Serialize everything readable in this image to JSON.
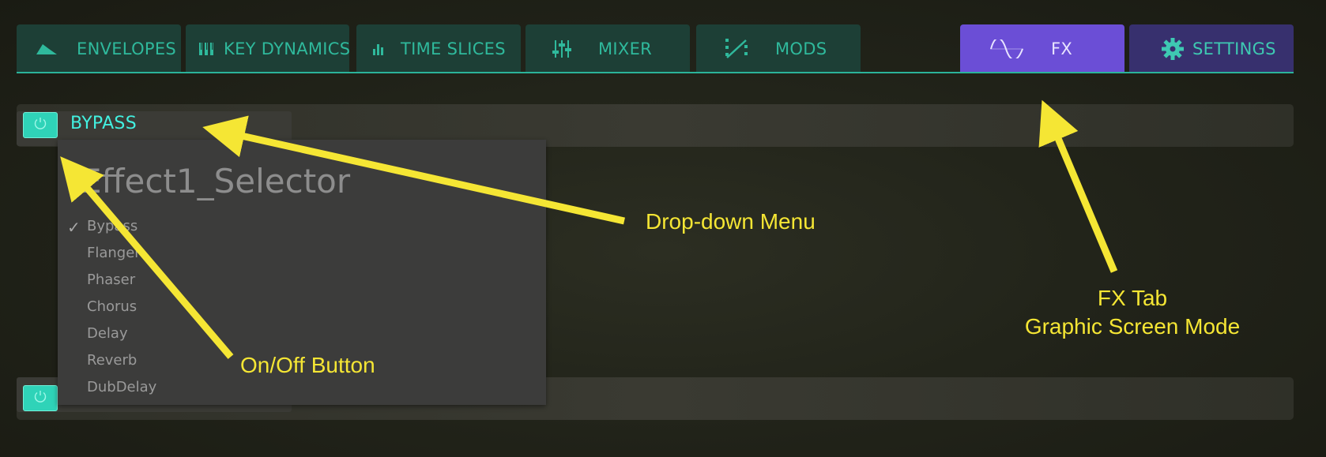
{
  "tabs": [
    {
      "label": "ENVELOPES",
      "icon": "envelope-shape-icon"
    },
    {
      "label": "KEY DYNAMICS",
      "icon": "key-dynamics-icon"
    },
    {
      "label": "TIME SLICES",
      "icon": "bar-graph-icon"
    },
    {
      "label": "MIXER",
      "icon": "mixer-sliders-icon"
    },
    {
      "label": "MODS",
      "icon": "modulation-icon"
    },
    {
      "label": "FX",
      "icon": "sine-wave-icon",
      "active": true
    },
    {
      "label": "SETTINGS",
      "icon": "gear-icon"
    }
  ],
  "effect_slot_1": {
    "selected": "BYPASS",
    "power_on": true
  },
  "dropdown": {
    "title": "Effect1_Selector",
    "options": [
      "Bypass",
      "Flanger",
      "Phaser",
      "Chorus",
      "Delay",
      "Reverb",
      "DubDelay"
    ],
    "checked": "Bypass"
  },
  "annotations": {
    "dropdown_menu": "Drop-down Menu",
    "on_off_button": "On/Off Button",
    "fx_tab_line1": "FX Tab",
    "fx_tab_line2": "Graphic Screen Mode"
  },
  "colors": {
    "tab_bg": "#1d3f36",
    "tab_text": "#2fb99c",
    "fx_tab_bg": "#6b4ed6",
    "settings_tab_bg": "#37306e",
    "accent_teal": "#2fd3b8",
    "annotation_yellow": "#f5e634"
  }
}
